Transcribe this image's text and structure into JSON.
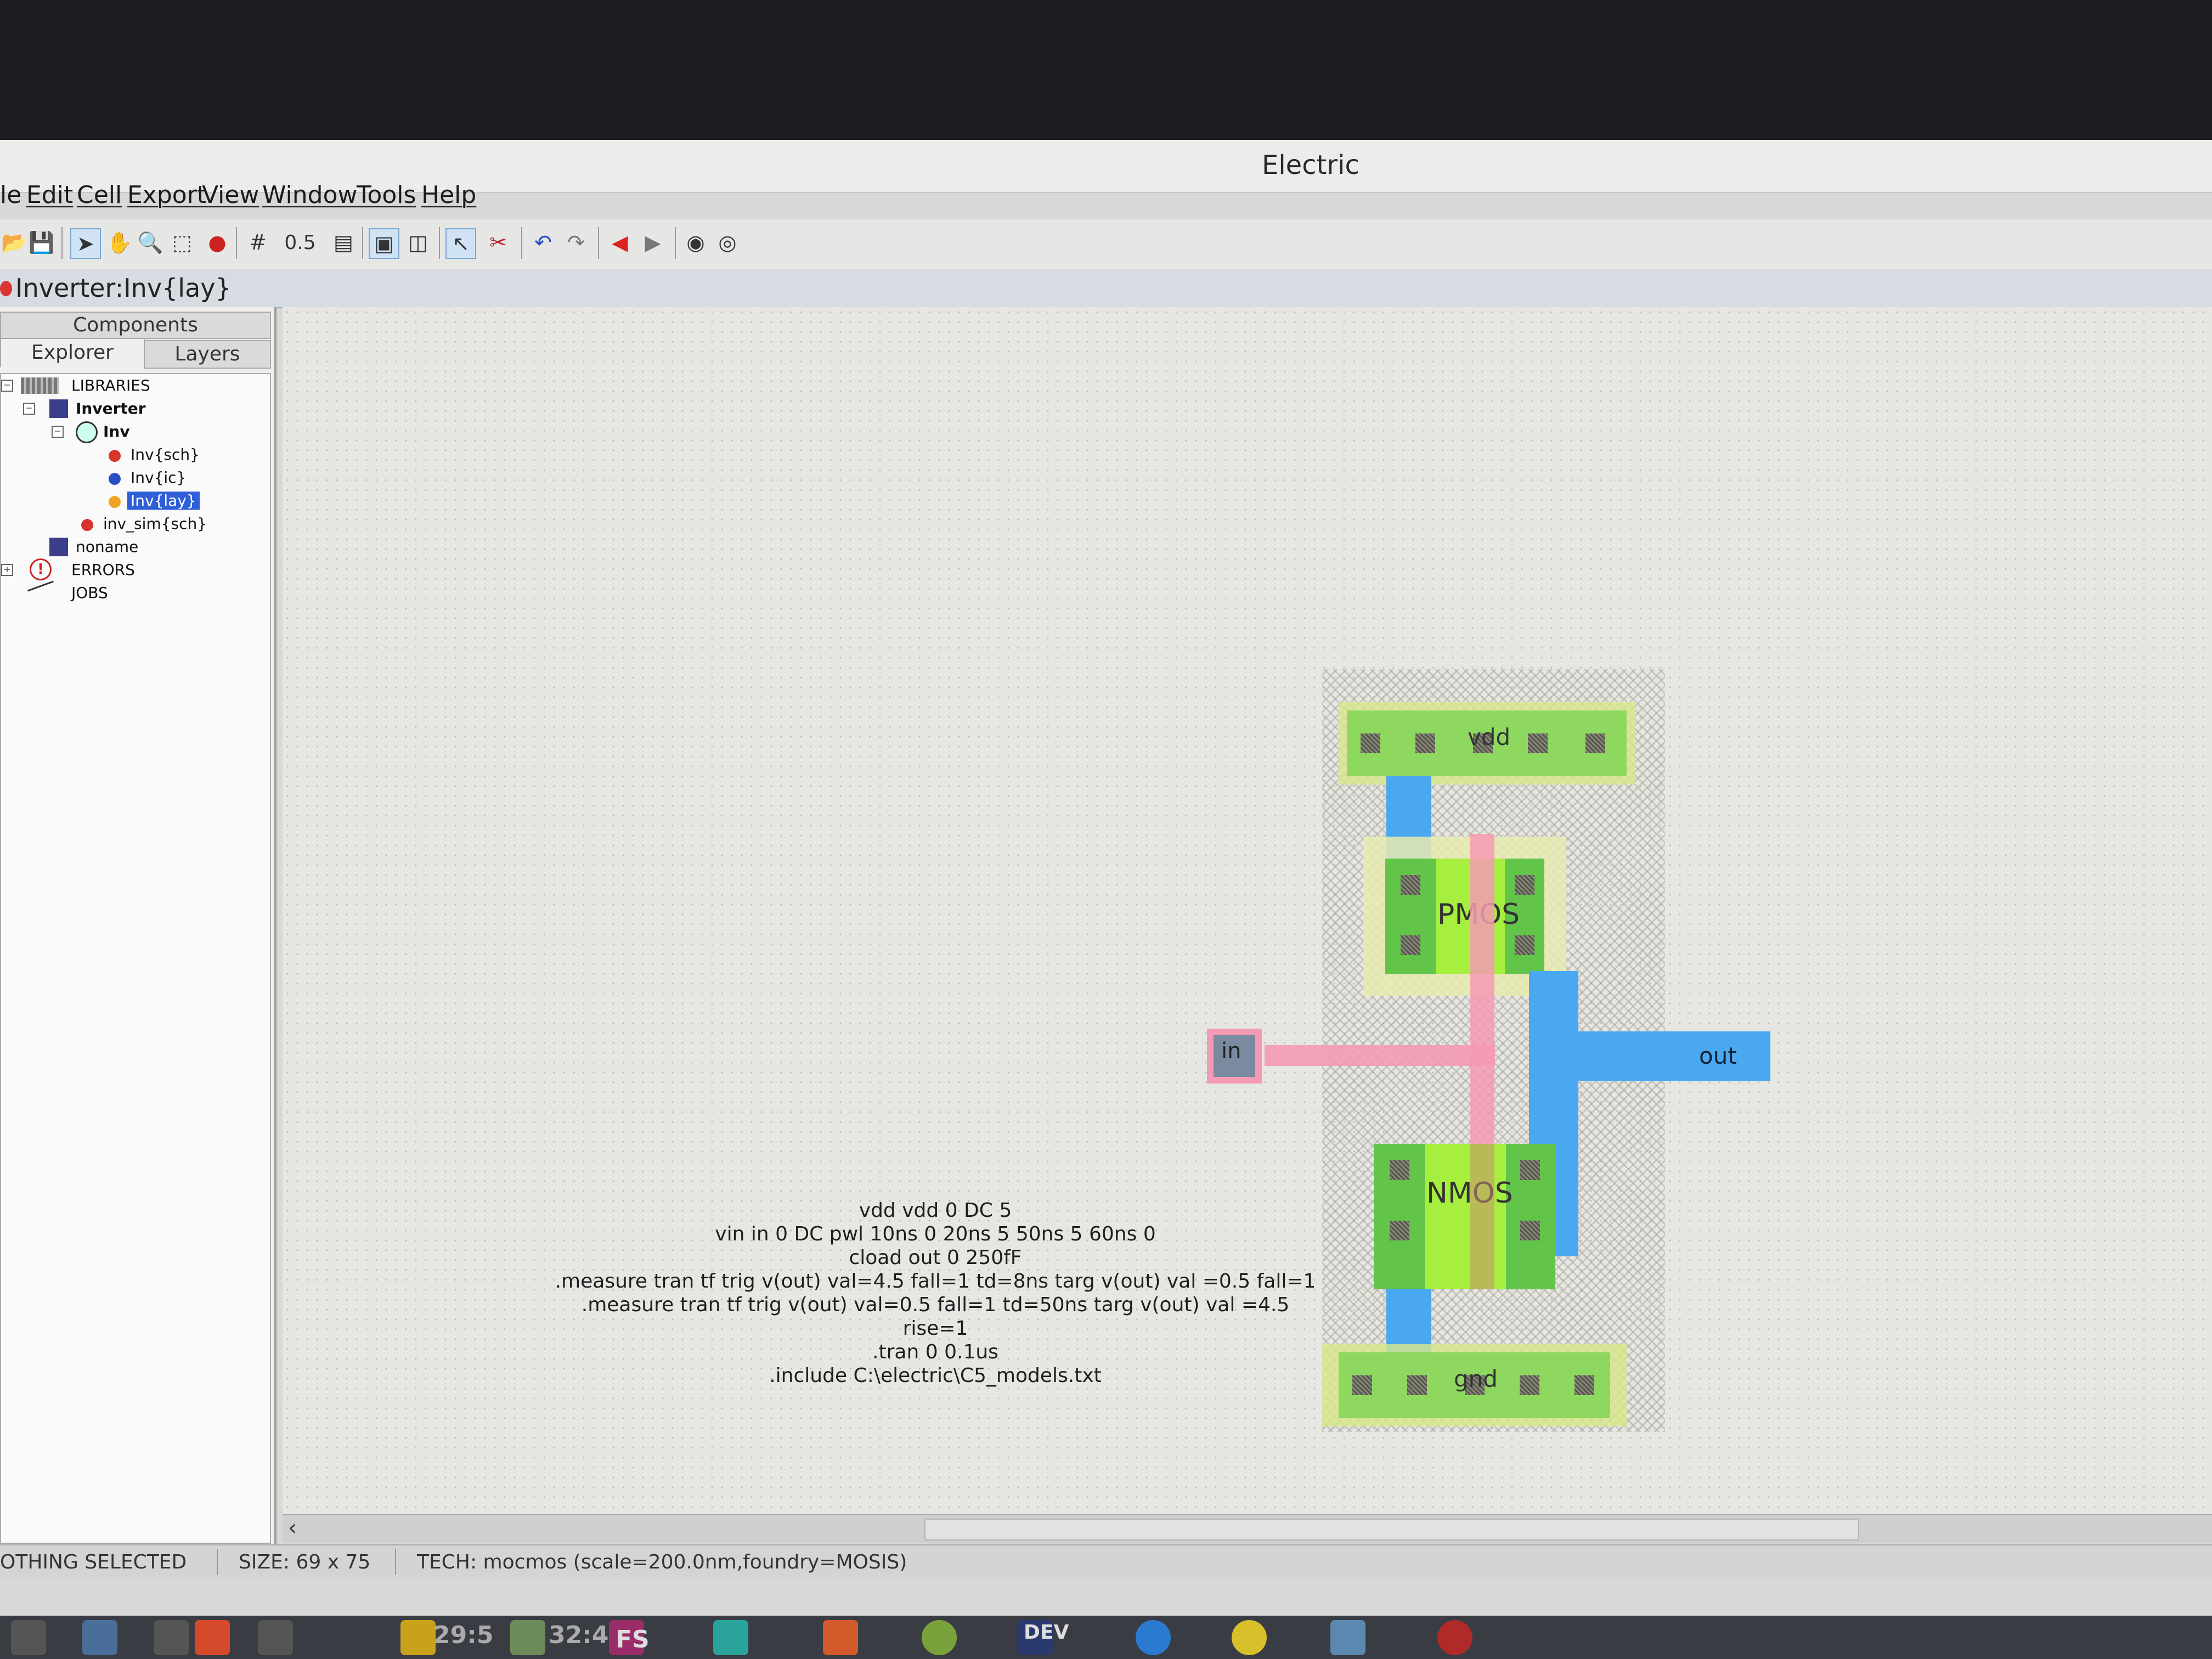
{
  "window": {
    "title": "Electric",
    "menu": [
      "le",
      "Edit",
      "Cell",
      "Export",
      "View",
      "Window",
      "Tools",
      "Help"
    ],
    "grid_value": "0.5",
    "cell_tab": "Inverter:Inv{lay}"
  },
  "panel": {
    "tabs": [
      "Components",
      "Explorer",
      "Layers"
    ],
    "tree": {
      "libraries": "LIBRARIES",
      "inverter": "Inverter",
      "inv": "Inv",
      "inv_sch": "Inv{sch}",
      "inv_ic": "Inv{ic}",
      "inv_lay": "Inv{lay}",
      "inv_sim": "inv_sim{sch}",
      "noname": "noname",
      "errors": "ERRORS",
      "jobs": "JOBS"
    }
  },
  "layout": {
    "vdd": "vdd",
    "gnd": "gnd",
    "pmos": "PMOS",
    "nmos": "NMOS",
    "in": "in",
    "out": "out"
  },
  "spice": {
    "l1": "vdd vdd 0 DC 5",
    "l2": "vin in 0 DC pwl 10ns 0 20ns 5 50ns 5 60ns 0",
    "l3": "cload out 0 250fF",
    "l4": ".measure tran tf trig v(out) val=4.5 fall=1 td=8ns targ v(out) val =0.5 fall=1",
    "l5": ".measure tran tf trig v(out) val=0.5 fall=1 td=50ns targ v(out) val =4.5 rise=1",
    "l6": ".tran 0 0.1us",
    "l7": ".include C:\\electric\\C5_models.txt"
  },
  "status": {
    "selection": "OTHING SELECTED",
    "size": "SIZE: 69 x 75",
    "tech": "TECH: mocmos (scale=200.0nm,foundry=MOSIS)"
  },
  "taskbar": {
    "time1": "29:5",
    "time2": "32:4",
    "fs": "FS",
    "dev": "DEV"
  },
  "colors": {
    "metal1": "#4aa8f0",
    "poly": "#f59ab4",
    "active": "#7ed957",
    "select": "#9eec4a",
    "well_hatch": "#bdbdb0"
  }
}
